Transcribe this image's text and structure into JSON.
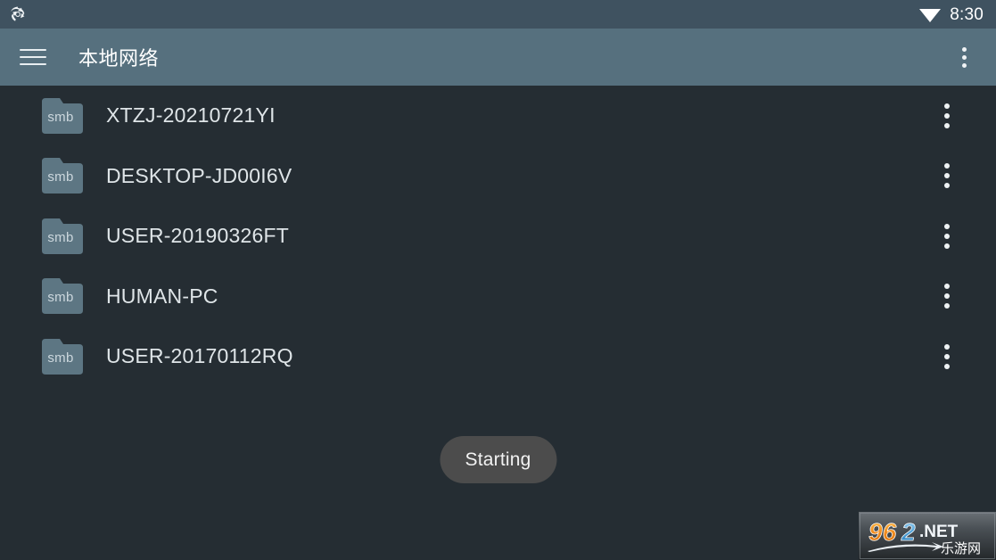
{
  "status_bar": {
    "app_icon": "sync-circle-icon",
    "wifi_icon": "wifi-icon",
    "clock": "8:30",
    "background_color": "#3f5260"
  },
  "app_bar": {
    "menu_icon": "hamburger-menu-icon",
    "title": "本地网络",
    "overflow_icon": "more-vertical-icon",
    "background_color": "#56707e"
  },
  "list": {
    "item_icon_label": "smb",
    "item_overflow_icon": "more-vertical-icon",
    "items": [
      {
        "name": "XTZJ-20210721YI",
        "icon_label": "smb"
      },
      {
        "name": "DESKTOP-JD00I6V",
        "icon_label": "smb"
      },
      {
        "name": "USER-20190326FT",
        "icon_label": "smb"
      },
      {
        "name": "HUMAN-PC",
        "icon_label": "smb"
      },
      {
        "name": "USER-20170112RQ",
        "icon_label": "smb"
      }
    ]
  },
  "toast": {
    "text": "Starting",
    "background_color": "#4c4c4c"
  },
  "watermark": {
    "digits_962": "962",
    "dot_net": ".NET",
    "chinese": "乐游网",
    "orange": "#f08a1e",
    "blue": "#4d9fd6"
  },
  "page": {
    "background_color": "#252d33"
  }
}
